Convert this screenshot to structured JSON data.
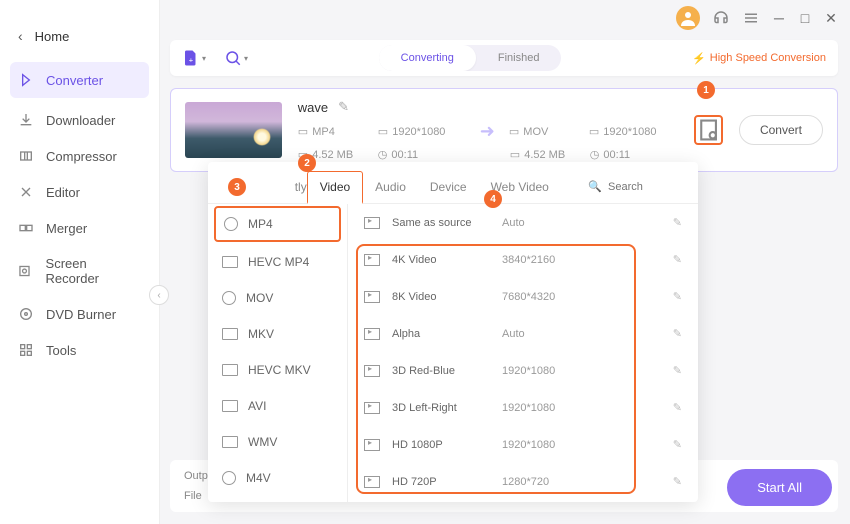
{
  "topbar": {
    "user_icon": "user",
    "headset_icon": "support",
    "menu_icon": "menu"
  },
  "sidebar": {
    "home": "Home",
    "items": [
      {
        "label": "Converter",
        "icon": "converter"
      },
      {
        "label": "Downloader",
        "icon": "download"
      },
      {
        "label": "Compressor",
        "icon": "compress"
      },
      {
        "label": "Editor",
        "icon": "editor"
      },
      {
        "label": "Merger",
        "icon": "merger"
      },
      {
        "label": "Screen Recorder",
        "icon": "recorder"
      },
      {
        "label": "DVD Burner",
        "icon": "dvd"
      },
      {
        "label": "Tools",
        "icon": "tools"
      }
    ]
  },
  "toolbar": {
    "tabs": {
      "converting": "Converting",
      "finished": "Finished"
    },
    "highspeed": "High Speed Conversion"
  },
  "item": {
    "title": "wave",
    "src": {
      "fmt": "MP4",
      "res": "1920*1080",
      "size": "4.52 MB",
      "dur": "00:11"
    },
    "dst": {
      "fmt": "MOV",
      "res": "1920*1080",
      "size": "4.52 MB",
      "dur": "00:11"
    },
    "convert": "Convert"
  },
  "badges": {
    "b1": "1",
    "b2": "2",
    "b3": "3",
    "b4": "4"
  },
  "popup": {
    "tabs": [
      "Recently",
      "Video",
      "Audio",
      "Device",
      "Web Video"
    ],
    "search_placeholder": "Search",
    "formats": [
      "MP4",
      "HEVC MP4",
      "MOV",
      "MKV",
      "HEVC MKV",
      "AVI",
      "WMV",
      "M4V"
    ],
    "presets": [
      {
        "name": "Same as source",
        "res": "Auto"
      },
      {
        "name": "4K Video",
        "res": "3840*2160"
      },
      {
        "name": "8K Video",
        "res": "7680*4320"
      },
      {
        "name": "Alpha",
        "res": "Auto"
      },
      {
        "name": "3D Red-Blue",
        "res": "1920*1080"
      },
      {
        "name": "3D Left-Right",
        "res": "1920*1080"
      },
      {
        "name": "HD 1080P",
        "res": "1920*1080"
      },
      {
        "name": "HD 720P",
        "res": "1280*720"
      }
    ]
  },
  "bottom": {
    "output": "Outp",
    "file": "File",
    "startall": "Start All"
  }
}
